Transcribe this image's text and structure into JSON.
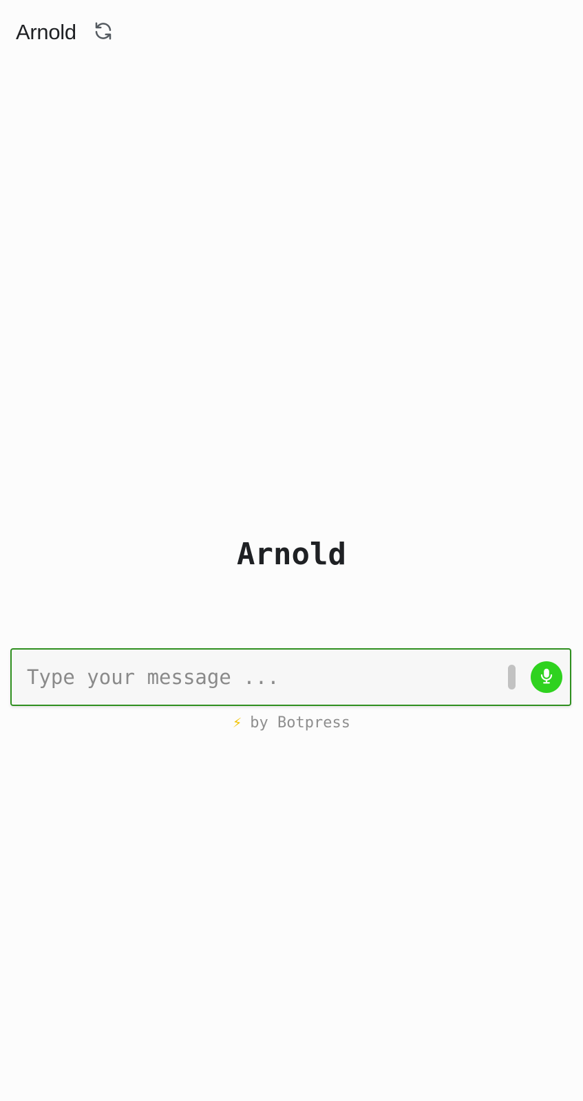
{
  "header": {
    "title": "Arnold",
    "refresh_icon": "refresh-icon"
  },
  "welcome": {
    "bot_name": "Arnold"
  },
  "composer": {
    "placeholder": "Type your message ...",
    "value": "",
    "mic_icon": "microphone-icon"
  },
  "footer": {
    "bolt_glyph": "⚡",
    "powered_by": "by Botpress"
  },
  "colors": {
    "accent": "#2fd21f",
    "composer_border": "#2f8f1f",
    "bolt": "#f2c200",
    "text": "#1f2124",
    "muted": "#8f8f8f",
    "background": "#fcfcfc"
  }
}
